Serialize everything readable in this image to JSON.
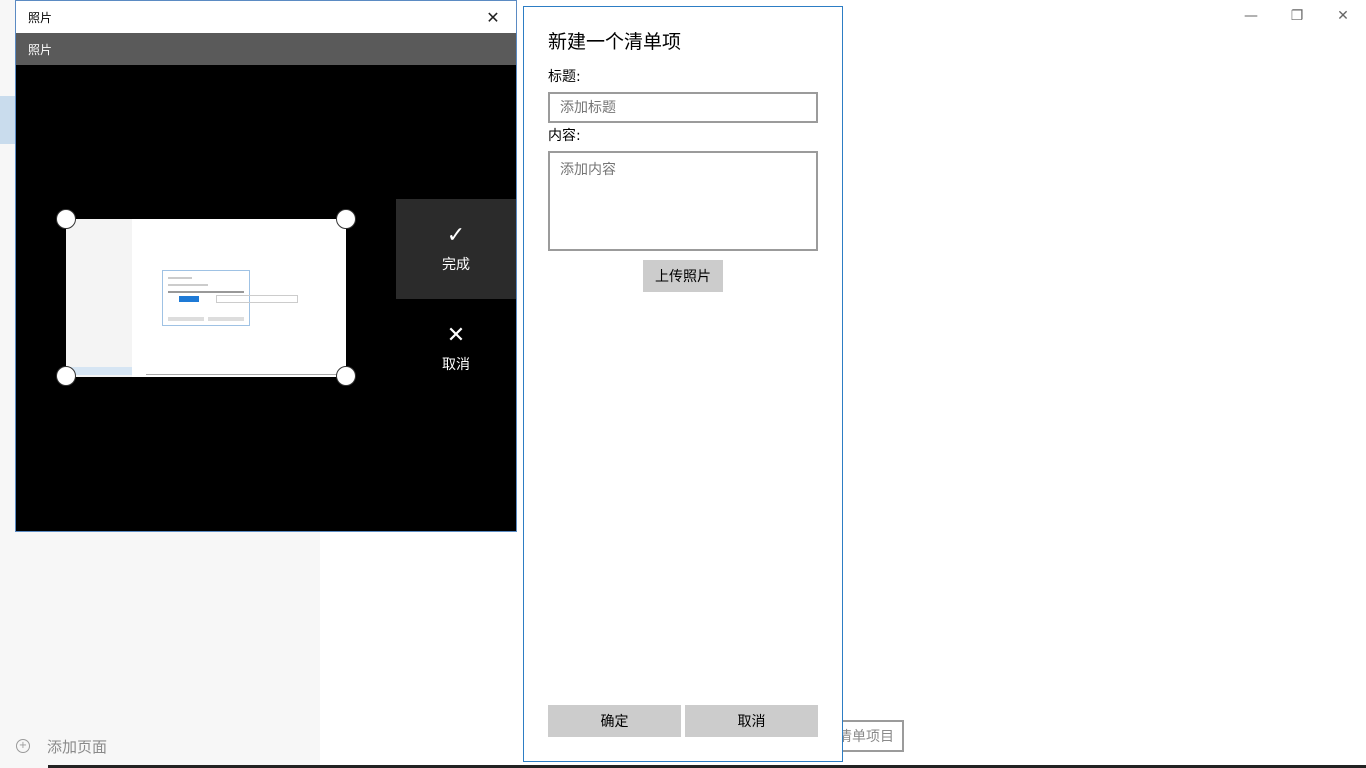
{
  "background": {
    "add_page_label": "添加页面",
    "partial_button_label": "清单项目",
    "window_controls": {
      "minimize": "—",
      "restore": "❐",
      "close": "✕"
    }
  },
  "photos_window": {
    "title": "照片",
    "app_label": "照片",
    "close_glyph": "✕",
    "done_label": "完成",
    "done_icon": "check-icon",
    "cancel_label": "取消",
    "cancel_icon": "close-icon"
  },
  "new_item_dialog": {
    "heading": "新建一个清单项",
    "title_label": "标题:",
    "title_placeholder": "添加标题",
    "content_label": "内容:",
    "content_placeholder": "添加内容",
    "upload_label": "上传照片",
    "confirm_label": "确定",
    "cancel_label": "取消"
  },
  "colors": {
    "accent_border": "#2d7dc4",
    "button_gray": "#cccccc",
    "app_bar": "#5a5a5a"
  }
}
